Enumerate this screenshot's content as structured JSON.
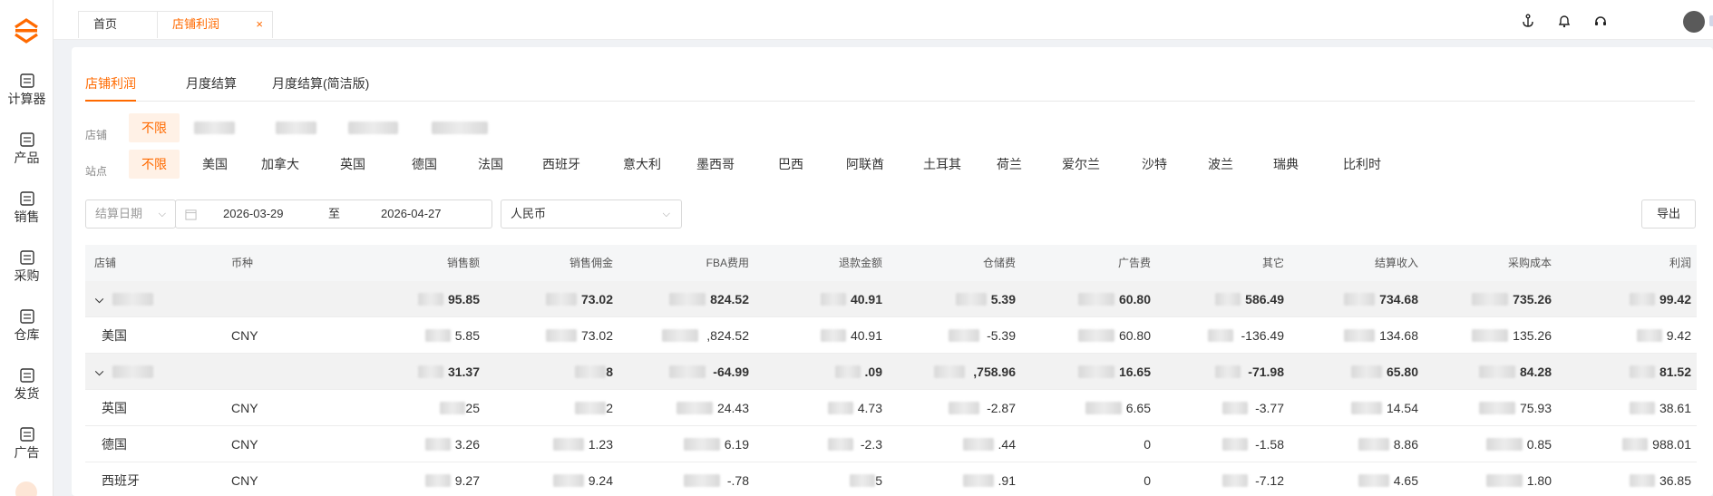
{
  "sidebar": {
    "items": [
      {
        "label": "计算器",
        "icon": "calculator-icon"
      },
      {
        "label": "产品",
        "icon": "box-icon"
      },
      {
        "label": "销售",
        "icon": "sales-icon"
      },
      {
        "label": "采购",
        "icon": "basket-icon"
      },
      {
        "label": "仓库",
        "icon": "warehouse-icon"
      },
      {
        "label": "发货",
        "icon": "shipping-icon"
      },
      {
        "label": "广告",
        "icon": "ad-icon"
      }
    ]
  },
  "topbar": {
    "tabs": [
      {
        "label": "首页"
      },
      {
        "label": "店铺利润",
        "close": "×"
      }
    ]
  },
  "subtabs": [
    "店铺利润",
    "月度结算",
    "月度结算(简洁版)"
  ],
  "filters": {
    "shop_label": "店铺",
    "shop_all": "不限",
    "site_label": "站点",
    "site_all": "不限",
    "sites": [
      "美国",
      "加拿大",
      "英国",
      "德国",
      "法国",
      "西班牙",
      "意大利",
      "墨西哥",
      "巴西",
      "阿联酋",
      "土耳其",
      "荷兰",
      "爱尔兰",
      "沙特",
      "波兰",
      "瑞典",
      "比利时"
    ],
    "date_type": "结算日期",
    "start_date": "2026-03-29",
    "range_sep": "至",
    "end_date": "2026-04-27",
    "currency": "人民币",
    "export_label": "导出"
  },
  "table": {
    "headers": [
      "店铺",
      "币种",
      "销售额",
      "销售佣金",
      "FBA费用",
      "退款金额",
      "仓储费",
      "广告费",
      "其它",
      "结算收入",
      "采购成本",
      "利润"
    ],
    "rows": [
      {
        "group": true,
        "shop": "",
        "currency": "",
        "cells": [
          "95.85",
          "73.02",
          "824.52",
          "40.91",
          "5.39",
          "60.80",
          "586.49",
          "734.68",
          "735.26",
          "99.42"
        ]
      },
      {
        "group": false,
        "shop": "美国",
        "currency": "CNY",
        "cells": [
          "5.85",
          "73.02",
          ",824.52",
          "40.91",
          "-5.39",
          "60.80",
          "-136.49",
          "134.68",
          "135.26",
          "9.42"
        ]
      },
      {
        "group": true,
        "shop": "",
        "currency": "",
        "cells": [
          "31.37",
          "8",
          "-64.99",
          ".09",
          ",758.96",
          "16.65",
          "-71.98",
          "65.80",
          "84.28",
          "81.52"
        ]
      },
      {
        "group": false,
        "shop": "英国",
        "currency": "CNY",
        "cells": [
          "25",
          "2",
          "24.43",
          "4.73",
          "-2.87",
          "6.65",
          "-3.77",
          "14.54",
          "75.93",
          "38.61"
        ]
      },
      {
        "group": false,
        "shop": "德国",
        "currency": "CNY",
        "cells": "3.26|1.23|6.19|-2.3|.44|0|-1.58|8.86|0.85|988.01"
      },
      {
        "group": false,
        "shop": "西班牙",
        "currency": "CNY",
        "cells": [
          "9.27",
          "9.24",
          "-.78",
          "5",
          ".91",
          "0",
          "-7.12",
          "4.65",
          "1.80",
          "36.85"
        ]
      }
    ]
  },
  "colors": {
    "accent": "#ff6a00",
    "group_bg": "#f2f2f2"
  }
}
